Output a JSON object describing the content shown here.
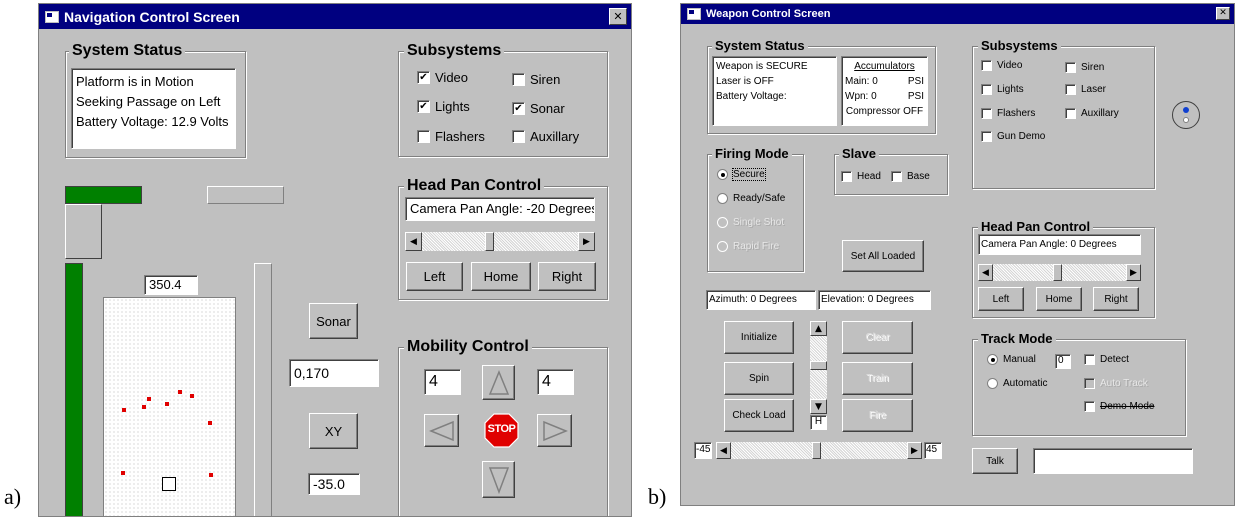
{
  "captions": {
    "a": "a)",
    "b": "b)"
  },
  "nav": {
    "title": "Navigation Control Screen",
    "close": "✕",
    "system_status": {
      "label": "System Status",
      "lines": [
        "Platform is in Motion",
        "Seeking Passage on Left",
        "Battery Voltage: 12.9 Volts"
      ]
    },
    "subsystems": {
      "label": "Subsystems",
      "items": [
        {
          "label": "Video",
          "checked": true
        },
        {
          "label": "Siren",
          "checked": false
        },
        {
          "label": "Lights",
          "checked": true
        },
        {
          "label": "Sonar",
          "checked": true
        },
        {
          "label": "Flashers",
          "checked": false
        },
        {
          "label": "Auxillary",
          "checked": false
        }
      ]
    },
    "head_pan": {
      "label": "Head Pan Control",
      "angle_text": "Camera Pan Angle: -20 Degrees",
      "left": "Left",
      "home": "Home",
      "right": "Right"
    },
    "range_value": "350.4",
    "sonar_button": "Sonar",
    "xy_value": "0,170",
    "xy_button": "XY",
    "heading_value": "-35.0",
    "mobility": {
      "label": "Mobility Control",
      "left_speed": "4",
      "right_speed": "4",
      "stop": "STOP"
    },
    "colors": {
      "bar": "#008000",
      "points": "#e00000",
      "stop": "#e00000"
    }
  },
  "weapon": {
    "title": "Weapon Control Screen",
    "close": "✕",
    "system_status": {
      "label": "System Status",
      "lines": [
        "Weapon is SECURE",
        "Laser is OFF",
        "Battery Voltage:"
      ]
    },
    "accumulators": {
      "label": "Accumulators",
      "main": "Main: 0",
      "main_unit": "PSI",
      "wpn": "Wpn: 0",
      "wpn_unit": "PSI",
      "compressor": "Compressor OFF"
    },
    "subsystems": {
      "label": "Subsystems",
      "items": [
        {
          "label": "Video",
          "checked": false
        },
        {
          "label": "Siren",
          "checked": false
        },
        {
          "label": "Lights",
          "checked": false
        },
        {
          "label": "Laser",
          "checked": false
        },
        {
          "label": "Flashers",
          "checked": false
        },
        {
          "label": "Auxillary",
          "checked": false
        },
        {
          "label": "Gun Demo",
          "checked": false
        }
      ]
    },
    "firing_mode": {
      "label": "Firing Mode",
      "options": [
        {
          "label": "Secure",
          "selected": true,
          "enabled": true
        },
        {
          "label": "Ready/Safe",
          "selected": false,
          "enabled": true
        },
        {
          "label": "Single Shot",
          "selected": false,
          "enabled": false
        },
        {
          "label": "Rapid Fire",
          "selected": false,
          "enabled": false
        }
      ]
    },
    "slave": {
      "label": "Slave",
      "head": "Head",
      "base": "Base"
    },
    "set_all_loaded": "Set All Loaded",
    "azimuth": "Azimuth: 0 Degrees",
    "elevation": "Elevation: 0 Degrees",
    "buttons": {
      "initialize": "Initialize",
      "spin": "Spin",
      "check_load": "Check Load",
      "clear": "Clear",
      "train": "Train",
      "fire": "Fire",
      "h": "H"
    },
    "az_min": "-45",
    "az_max": "45",
    "head_pan": {
      "label": "Head Pan Control",
      "angle_text": "Camera Pan Angle: 0 Degrees",
      "left": "Left",
      "home": "Home",
      "right": "Right"
    },
    "track_mode": {
      "label": "Track Mode",
      "manual": "Manual",
      "manual_value": "0",
      "automatic": "Automatic",
      "detect": "Detect",
      "auto_track": "Auto Track",
      "demo_mode": "Demo Mode"
    },
    "talk": "Talk",
    "talk_value": ""
  }
}
